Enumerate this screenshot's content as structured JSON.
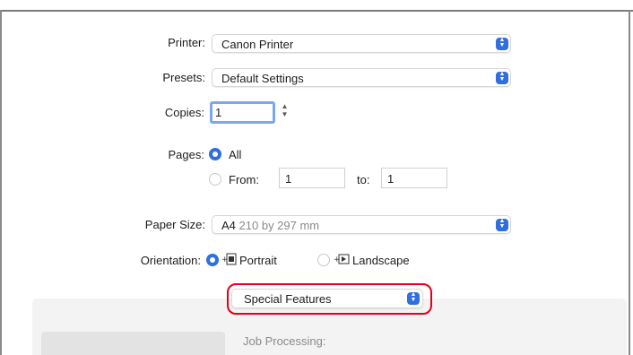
{
  "printer": {
    "label": "Printer:",
    "value": "Canon Printer"
  },
  "presets": {
    "label": "Presets:",
    "value": "Default Settings"
  },
  "copies": {
    "label": "Copies:",
    "value": "1"
  },
  "pages": {
    "label": "Pages:",
    "all_label": "All",
    "from_label": "From:",
    "from_value": "1",
    "to_label": "to:",
    "to_value": "1",
    "selected": "All"
  },
  "paper_size": {
    "label": "Paper Size:",
    "name": "A4",
    "dimensions": "210 by 297 mm"
  },
  "orientation": {
    "label": "Orientation:",
    "portrait_label": "Portrait",
    "landscape_label": "Landscape",
    "selected": "Portrait"
  },
  "section_popup": {
    "value": "Special Features"
  },
  "panel": {
    "job_processing_label": "Job Processing:"
  },
  "colors": {
    "accent": "#2f6fe0",
    "highlight": "#e2001a",
    "panel": "#f3f3f3"
  },
  "icons": {
    "popup_arrows": "chevron-up-down-icon",
    "portrait": "portrait-orientation-icon",
    "landscape": "landscape-orientation-icon"
  }
}
